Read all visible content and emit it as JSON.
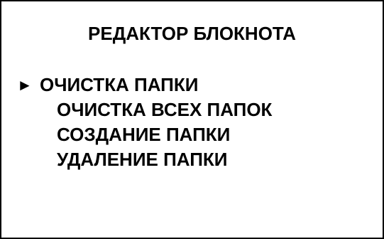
{
  "title": "РЕДАКТОР БЛОКНОТА",
  "selection_marker": "►",
  "menu": {
    "selected_index": 0,
    "items": [
      {
        "label": "ОЧИСТКА ПАПКИ"
      },
      {
        "label": "ОЧИСТКА ВСЕХ ПАПОК"
      },
      {
        "label": "СОЗДАНИЕ ПАПКИ"
      },
      {
        "label": "УДАЛЕНИЕ ПАПКИ"
      }
    ]
  },
  "colors": {
    "background": "#ffffff",
    "text": "#000000",
    "border": "#000000"
  }
}
